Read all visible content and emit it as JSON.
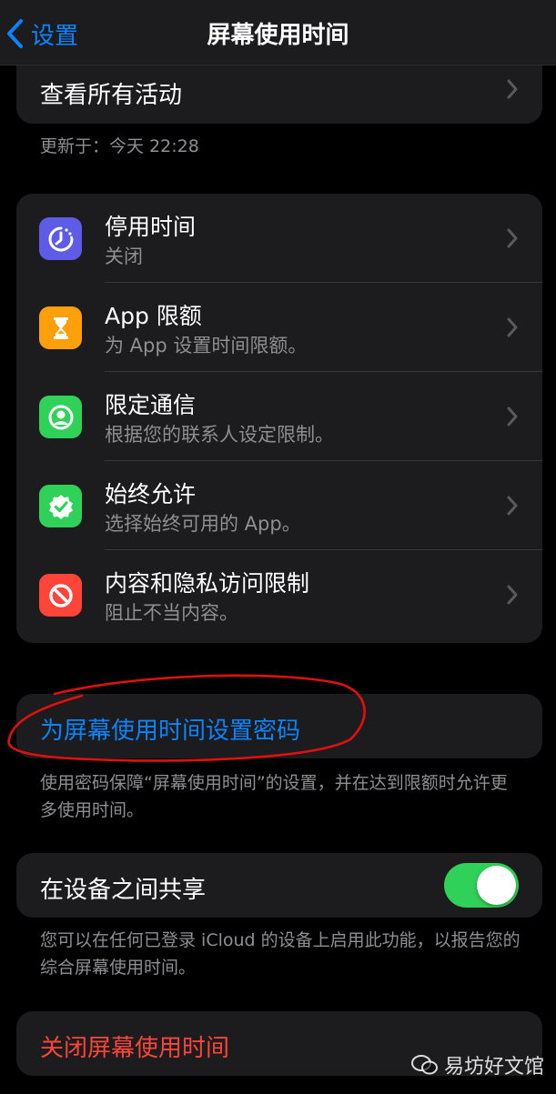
{
  "nav": {
    "back_label": "设置",
    "title": "屏幕使用时间"
  },
  "activity": {
    "label": "查看所有活动",
    "updated": "更新于：今天 22:28"
  },
  "features": [
    {
      "title": "停用时间",
      "subtitle": "关闭",
      "icon": "downtime-icon",
      "color": "#5e5ce6"
    },
    {
      "title": "App 限额",
      "subtitle": "为 App 设置时间限额。",
      "icon": "hourglass-icon",
      "color": "#ff9f0a"
    },
    {
      "title": "限定通信",
      "subtitle": "根据您的联系人设定限制。",
      "icon": "contact-icon",
      "color": "#30d158"
    },
    {
      "title": "始终允许",
      "subtitle": "选择始终可用的 App。",
      "icon": "checkmark-badge-icon",
      "color": "#30d158"
    },
    {
      "title": "内容和隐私访问限制",
      "subtitle": "阻止不当内容。",
      "icon": "restriction-icon",
      "color": "#ff453a"
    }
  ],
  "passcode": {
    "label": "为屏幕使用时间设置密码",
    "footnote": "使用密码保障“屏幕使用时间”的设置，并在达到限额时允许更多使用时间。"
  },
  "share": {
    "label": "在设备之间共享",
    "enabled": true,
    "footnote": "您可以在任何已登录 iCloud 的设备上启用此功能，以报告您的综合屏幕使用时间。"
  },
  "turn_off": {
    "label": "关闭屏幕使用时间"
  },
  "watermark": {
    "text": "易坊好文馆"
  },
  "colors": {
    "accent": "#0a84ff",
    "destructive": "#ff453a",
    "toggle_on": "#30d158",
    "annotation": "#e0100f"
  }
}
